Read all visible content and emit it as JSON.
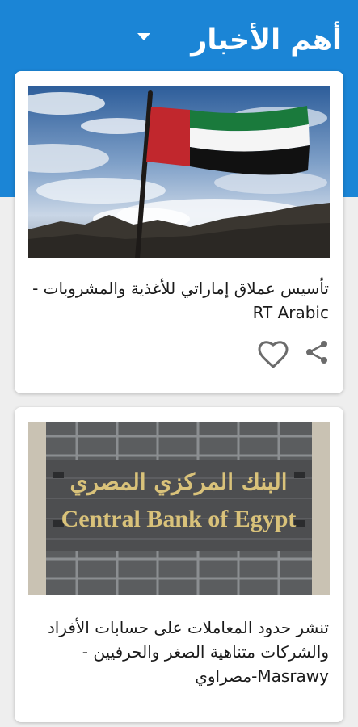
{
  "header": {
    "title": "أهم الأخبار",
    "caret_icon": "caret-down-icon",
    "background": "#1b85d6"
  },
  "articles": [
    {
      "image": "uae-flag-photo",
      "headline": "تأسيس عملاق إماراتي للأغذية والمشروبات - RT Arabic",
      "heart_icon": "heart-icon",
      "share_icon": "share-icon"
    },
    {
      "image": "central-bank-of-egypt-photo",
      "image_sign_arabic": "البنك المركزي المصري",
      "image_sign_english": "Central Bank of Egypt",
      "headline": "تنشر حدود المعاملات على حسابات الأفراد والشركات متناهية الصغر والحرفيين - Masrawy-مصراوي"
    }
  ]
}
